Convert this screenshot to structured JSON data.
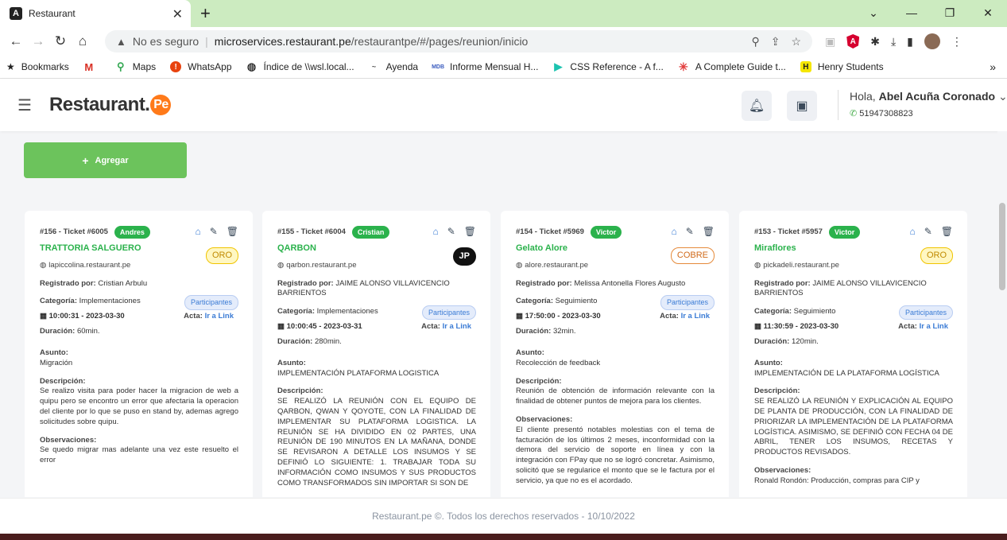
{
  "browser": {
    "tab_title": "Restaurant",
    "url_warning": "No es seguro",
    "url_host": "microservices.restaurant.pe",
    "url_path": "/restaurantpe/#/pages/reunion/inicio",
    "bookmarks": [
      {
        "label": "Bookmarks",
        "color": "#222"
      },
      {
        "label": "",
        "color": "#d93025"
      },
      {
        "label": "Maps",
        "color": "#34a853"
      },
      {
        "label": "WhatsApp",
        "color": "#e8430f"
      },
      {
        "label": "Índice de \\\\wsl.local...",
        "color": "#333"
      },
      {
        "label": "Ayenda",
        "color": "#555"
      },
      {
        "label": "Informe Mensual H...",
        "color": "#3a5bbf"
      },
      {
        "label": "CSS Reference - A f...",
        "color": "#1cc3b0"
      },
      {
        "label": "A Complete Guide t...",
        "color": "#e23c3c"
      },
      {
        "label": "Henry Students",
        "color": "#f5e600"
      }
    ]
  },
  "header": {
    "logo_text": "Restaurant.",
    "logo_pe": "Pe",
    "greeting": "Hola,",
    "user_name": "Abel Acuña Coronado",
    "phone": "51947308823"
  },
  "add_button": "Agregar",
  "labels": {
    "registrado": "Registrado por:",
    "categoria": "Categoría:",
    "duracion": "Duración:",
    "asunto": "Asunto:",
    "descripcion": "Descripción:",
    "observaciones": "Observaciones:",
    "participantes": "Participantes",
    "acta": "Acta:",
    "ir_link": "Ir a Link"
  },
  "cards": [
    {
      "ticket": "#156 - Ticket #6005",
      "user": "Andres",
      "name": "TRATTORIA SALGUERO",
      "badge": "ORO",
      "site": "lapiccolina.restaurant.pe",
      "registrado": "Cristian Arbulu",
      "categoria": "Implementaciones",
      "datetime": "10:00:31 - 2023-03-30",
      "duracion": "60min.",
      "asunto": "Migración",
      "descripcion": "Se realizo visita para poder hacer la migracion de web a quipu pero se encontro un error que afectaria la operacion del cliente por lo que se puso en stand by, ademas agrego solicitudes sobre quipu.",
      "observaciones": "Se quedo migrar mas adelante una vez este resuelto el error"
    },
    {
      "ticket": "#155 - Ticket #6004",
      "user": "Cristian",
      "name": "QARBON",
      "badge": "JP",
      "site": "qarbon.restaurant.pe",
      "registrado": "JAIME ALONSO VILLAVICENCIO BARRIENTOS",
      "categoria": "Implementaciones",
      "datetime": "10:00:45 - 2023-03-31",
      "duracion": "280min.",
      "asunto": "IMPLEMENTACIÓN PLATAFORMA LOGISTICA",
      "descripcion": "SE REALIZÓ LA REUNIÓN CON EL EQUIPO DE QARBON, QWAN Y QOYOTE, CON LA FINALIDAD DE IMPLEMENTAR SU PLATAFORMA LOGISTICA. LA REUNIÓN SE HA DIVIDIDO EN 02 PARTES, UNA REUNIÓN DE 190 MINUTOS EN LA MAÑANA, DONDE SE REVISARON A DETALLE LOS INSUMOS Y SE DEFINIÓ LO SIGUIENTE: 1. TRABAJAR TODA SU INFORMACIÓN COMO INSUMOS Y SUS PRODUCTOS COMO TRANSFORMADOS SIN IMPORTAR SI SON DE",
      "observaciones": ""
    },
    {
      "ticket": "#154 - Ticket #5969",
      "user": "Victor",
      "name": "Gelato Alore",
      "badge": "COBRE",
      "site": "alore.restaurant.pe",
      "registrado": "Melissa Antonella Flores Augusto",
      "categoria": "Seguimiento",
      "datetime": "17:50:00 - 2023-03-30",
      "duracion": "32min.",
      "asunto": "Recolección de feedback",
      "descripcion": "Reunión de obtención de información relevante con la finalidad de obtener puntos de mejora para los clientes.",
      "observaciones": "El cliente presentó notables molestias con el tema de facturación de los últimos 2 meses, inconformidad con la demora del servicio de soporte en línea y con la integración con FPay que no se logró concretar. Asimismo, solicitó que se regularice el monto que se le factura por el servicio, ya que no es el acordado."
    },
    {
      "ticket": "#153 - Ticket #5957",
      "user": "Victor",
      "name": "Miraflores",
      "badge": "ORO",
      "site": "pickadeli.restaurant.pe",
      "registrado": "JAIME ALONSO VILLAVICENCIO BARRIENTOS",
      "categoria": "Seguimiento",
      "datetime": "11:30:59 - 2023-03-30",
      "duracion": "120min.",
      "asunto": "IMPLEMENTACIÓN DE LA PLATAFORMA LOGÍSTICA",
      "descripcion": "SE REALIZÓ LA REUNIÓN Y EXPLICACIÓN AL EQUIPO DE PLANTA DE PRODUCCIÓN, CON LA FINALIDAD DE PRIORIZAR LA IMPLEMENTACIÓN DE LA PLATAFORMA LOGÍSTICA. ASIMISMO, SE DEFINIÓ CON FECHA 04 DE ABRIL, TENER LOS INSUMOS, RECETAS Y PRODUCTOS REVISADOS.",
      "observaciones": "Ronald Rondón: Producción, compras para CIP y"
    }
  ],
  "footer": "Restaurant.pe ©. Todos los derechos reservados - 10/10/2022"
}
